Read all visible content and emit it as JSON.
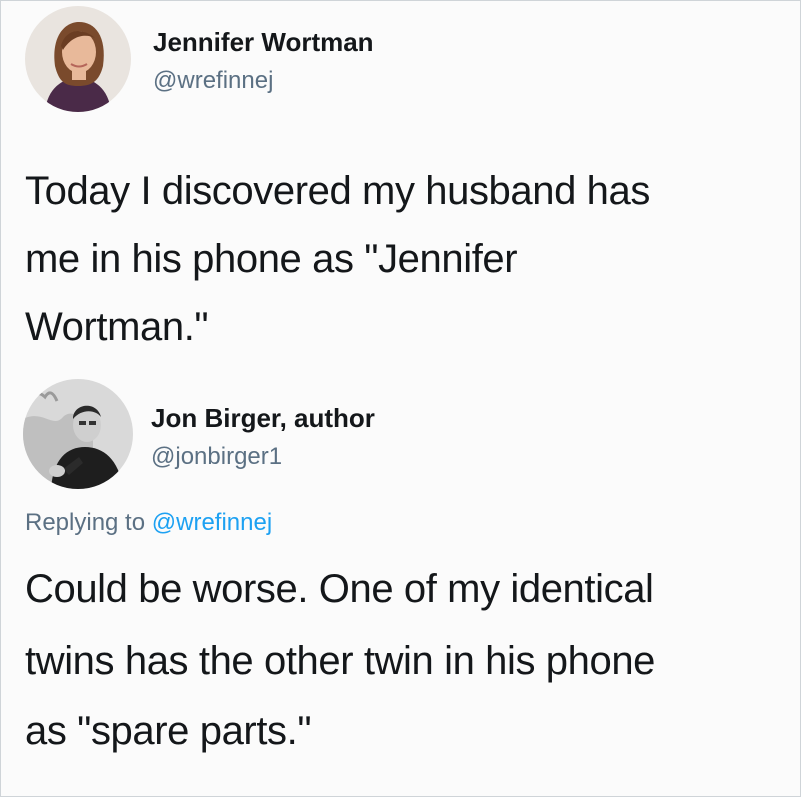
{
  "original_tweet": {
    "display_name": "Jennifer Wortman",
    "handle": "@wrefinnej",
    "avatar_icon": "user-avatar-woman",
    "text_lines": [
      "Today I discovered my husband has",
      "me in his phone as \"Jennifer",
      "Wortman.\""
    ]
  },
  "reply_tweet": {
    "display_name": "Jon Birger, author",
    "handle": "@jonbirger1",
    "avatar_icon": "user-avatar-man",
    "replying_prefix": "Replying to",
    "replying_mention": "@wrefinnej",
    "text_lines": [
      "Could be worse. One of my identical",
      "twins has the other twin in his phone",
      "as \"spare parts.\""
    ]
  },
  "colors": {
    "text": "#14171a",
    "muted": "#5b7083",
    "mention": "#1da1f2"
  }
}
